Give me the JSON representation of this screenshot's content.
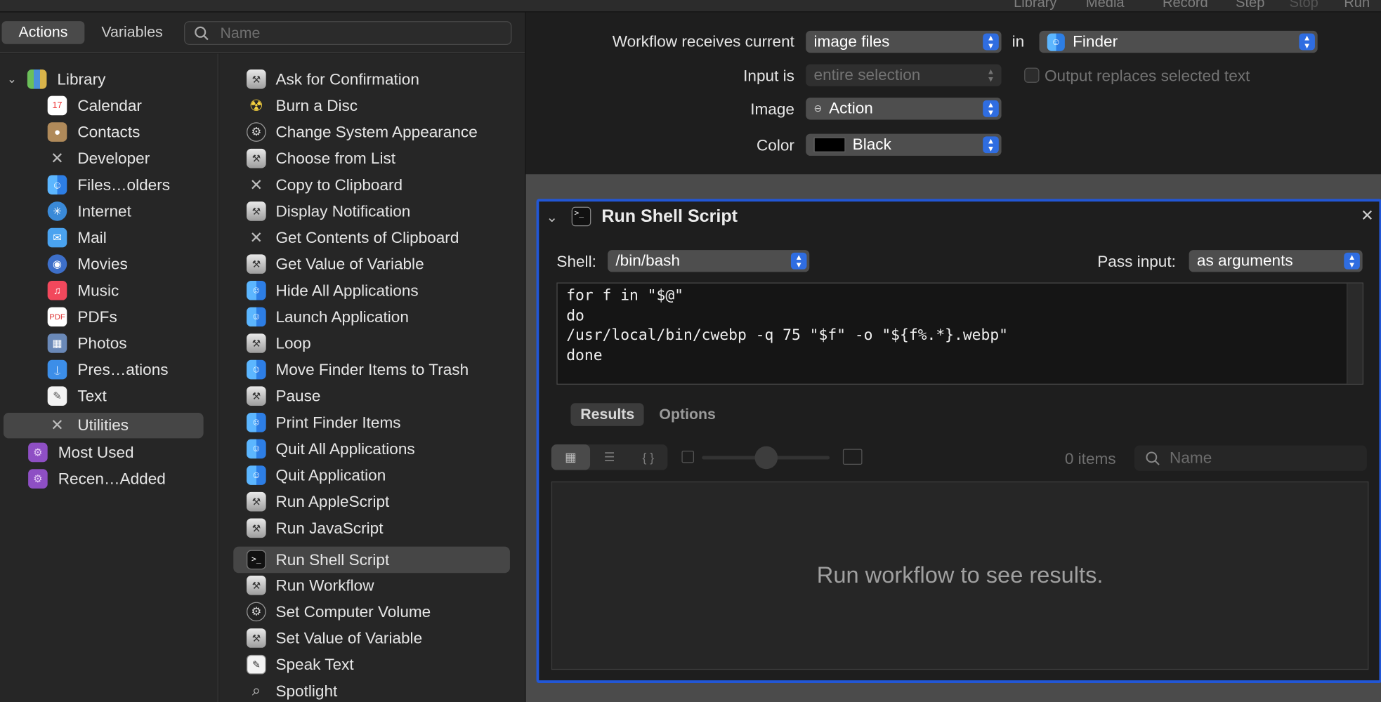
{
  "toolbar": {
    "library": "Library",
    "media": "Media",
    "record": "Record",
    "step": "Step",
    "stop": "Stop",
    "run": "Run"
  },
  "left": {
    "tabs": {
      "actions": "Actions",
      "variables": "Variables"
    },
    "search_placeholder": "Name",
    "library": [
      {
        "label": "Library",
        "icon": "books-icon"
      },
      {
        "label": "Calendar",
        "icon": "calendar-icon"
      },
      {
        "label": "Contacts",
        "icon": "contacts-icon"
      },
      {
        "label": "Developer",
        "icon": "tools-icon"
      },
      {
        "label": "Files…olders",
        "icon": "finder-icon"
      },
      {
        "label": "Internet",
        "icon": "globe-icon"
      },
      {
        "label": "Mail",
        "icon": "mail-icon"
      },
      {
        "label": "Movies",
        "icon": "movies-icon"
      },
      {
        "label": "Music",
        "icon": "music-icon"
      },
      {
        "label": "PDFs",
        "icon": "pdf-icon"
      },
      {
        "label": "Photos",
        "icon": "photos-icon"
      },
      {
        "label": "Pres…ations",
        "icon": "keynote-icon"
      },
      {
        "label": "Text",
        "icon": "text-edit-icon"
      },
      {
        "label": "Utilities",
        "icon": "tools-icon"
      },
      {
        "label": "Most Used",
        "icon": "smart-folder-icon"
      },
      {
        "label": "Recen…Added",
        "icon": "smart-folder-icon"
      }
    ],
    "actions": [
      {
        "label": "Ask for Confirmation",
        "icon": "automator-icon"
      },
      {
        "label": "Burn a Disc",
        "icon": "burn-icon"
      },
      {
        "label": "Change System Appearance",
        "icon": "settings-icon"
      },
      {
        "label": "Choose from List",
        "icon": "automator-icon"
      },
      {
        "label": "Copy to Clipboard",
        "icon": "tools-icon"
      },
      {
        "label": "Display Notification",
        "icon": "automator-icon"
      },
      {
        "label": "Get Contents of Clipboard",
        "icon": "tools-icon"
      },
      {
        "label": "Get Value of Variable",
        "icon": "automator-icon"
      },
      {
        "label": "Hide All Applications",
        "icon": "finder-icon"
      },
      {
        "label": "Launch Application",
        "icon": "finder-icon"
      },
      {
        "label": "Loop",
        "icon": "automator-icon"
      },
      {
        "label": "Move Finder Items to Trash",
        "icon": "finder-icon"
      },
      {
        "label": "Pause",
        "icon": "automator-icon"
      },
      {
        "label": "Print Finder Items",
        "icon": "finder-icon"
      },
      {
        "label": "Quit All Applications",
        "icon": "finder-icon"
      },
      {
        "label": "Quit Application",
        "icon": "finder-icon"
      },
      {
        "label": "Run AppleScript",
        "icon": "automator-icon"
      },
      {
        "label": "Run JavaScript",
        "icon": "automator-icon"
      },
      {
        "label": "Run Shell Script",
        "icon": "terminal-icon"
      },
      {
        "label": "Run Workflow",
        "icon": "automator-icon"
      },
      {
        "label": "Set Computer Volume",
        "icon": "settings-icon"
      },
      {
        "label": "Set Value of Variable",
        "icon": "automator-icon"
      },
      {
        "label": "Speak Text",
        "icon": "text-edit-icon"
      },
      {
        "label": "Spotlight",
        "icon": "spotlight-icon"
      }
    ]
  },
  "workflow": {
    "receives_label": "Workflow receives current",
    "receives_value": "image files",
    "in_label": "in",
    "in_value": "Finder",
    "input_is_label": "Input is",
    "input_is_value": "entire selection",
    "output_replaces": "Output replaces selected text",
    "image_label": "Image",
    "image_value": "Action",
    "color_label": "Color",
    "color_value": "Black",
    "color_swatch": "#000000"
  },
  "action": {
    "title": "Run Shell Script",
    "shell_label": "Shell:",
    "shell_value": "/bin/bash",
    "pass_input_label": "Pass input:",
    "pass_input_value": "as arguments",
    "script": "for f in \"$@\"\ndo\n/usr/local/bin/cwebp -q 75 \"$f\" -o \"${f%.*}.webp\"\ndone",
    "tabs": {
      "results": "Results",
      "options": "Options"
    },
    "items_count": "0 items",
    "results_search_placeholder": "Name",
    "results_message": "Run workflow to see results."
  },
  "accent_color": "#2257d6"
}
